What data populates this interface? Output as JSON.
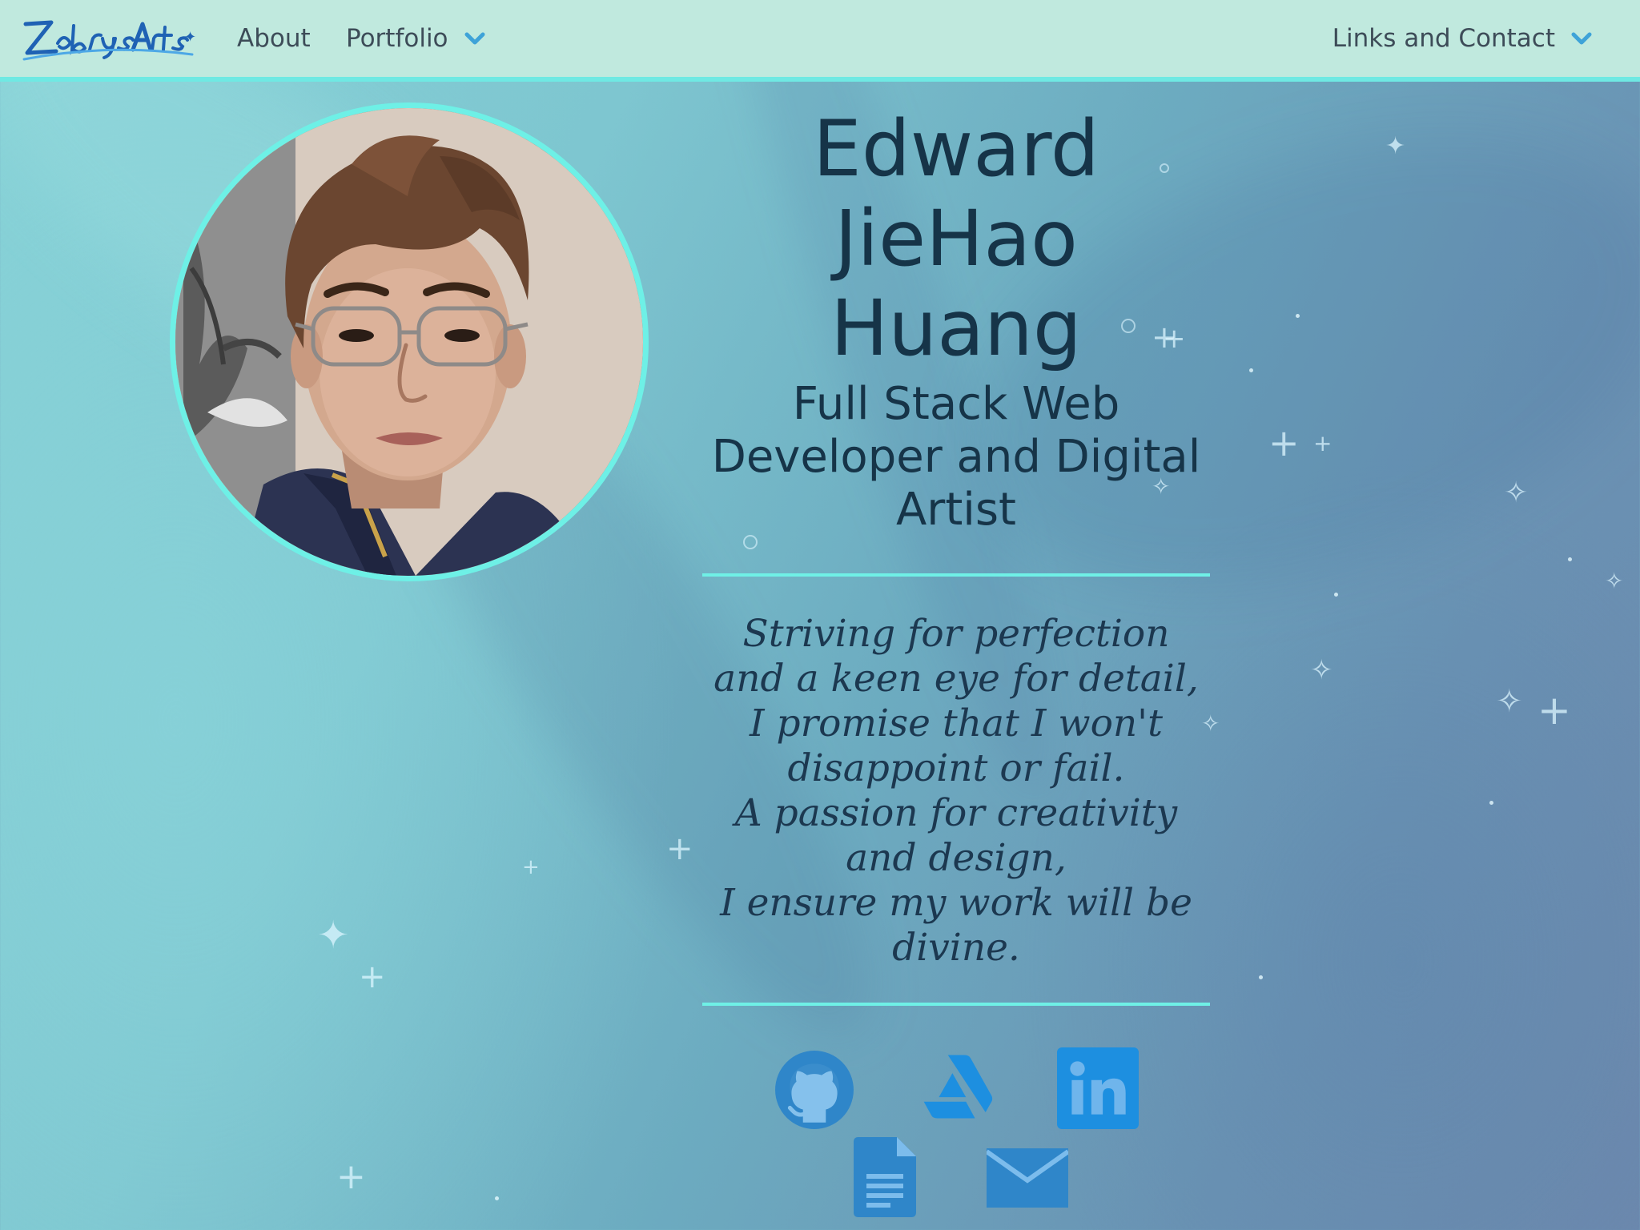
{
  "navbar": {
    "logo_text": "ZebrysArts",
    "items": [
      {
        "label": "About"
      },
      {
        "label": "Portfolio",
        "has_dropdown": true
      },
      {
        "label": "Links and Contact",
        "has_dropdown": true
      }
    ]
  },
  "profile": {
    "name_lines": [
      "Edward",
      "JieHao",
      "Huang"
    ],
    "role_lines": [
      "Full Stack Web",
      "Developer and Digital",
      "Artist"
    ],
    "motto_lines": [
      "Striving for perfection",
      "and a keen eye for detail,",
      "I promise that I won't",
      "disappoint or fail.",
      "A passion for creativity",
      "and design,",
      "I ensure my work will be",
      "divine."
    ]
  },
  "social_links": [
    {
      "name": "github",
      "icon": "github-icon"
    },
    {
      "name": "artstation",
      "icon": "artstation-icon"
    },
    {
      "name": "linkedin",
      "icon": "linkedin-icon"
    },
    {
      "name": "resume",
      "icon": "document-icon"
    },
    {
      "name": "email",
      "icon": "mail-icon"
    }
  ],
  "colors": {
    "navbar_bg": "#c0e9de",
    "accent": "#6ff0e6",
    "text_dark": "#163448",
    "icon_blue": "#2f86c9"
  }
}
